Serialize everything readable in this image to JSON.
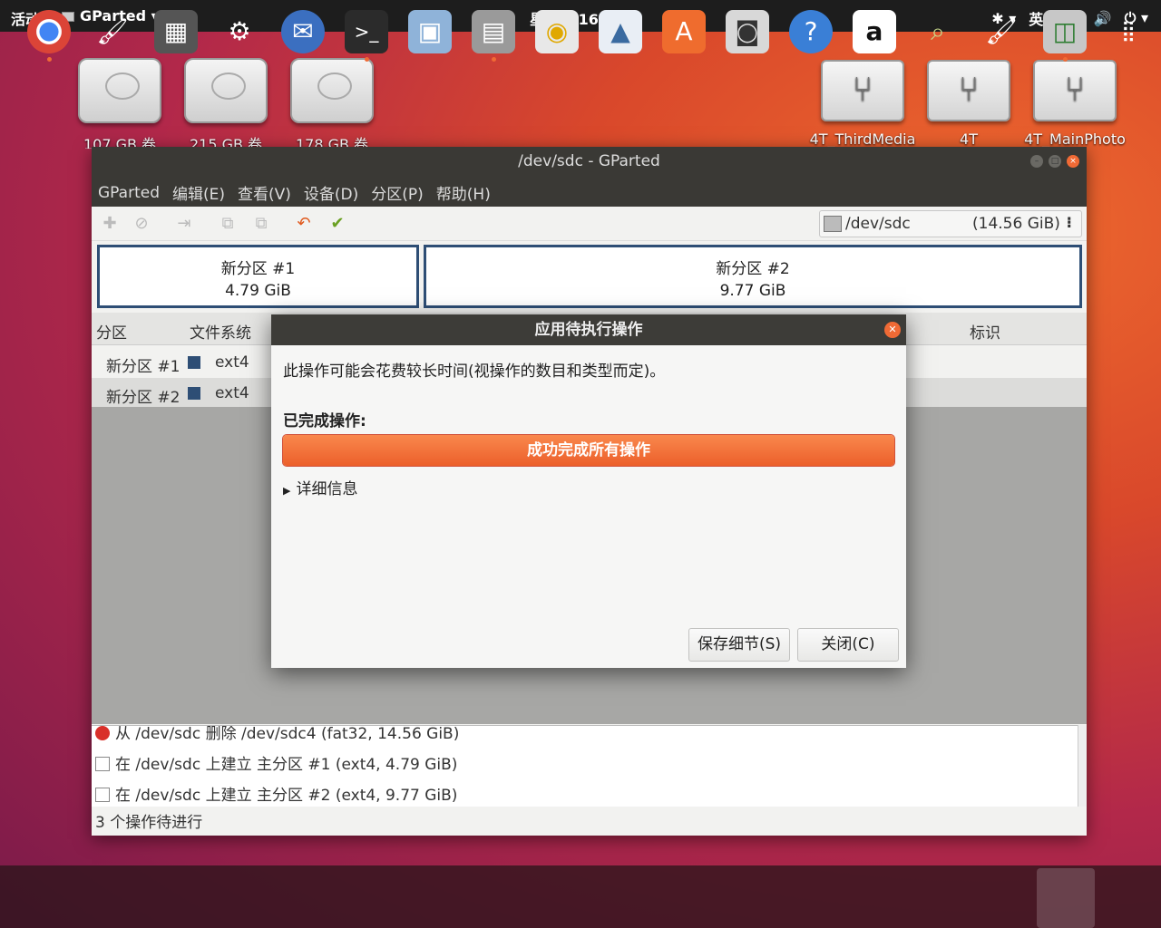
{
  "topbar": {
    "activities": "活动",
    "app_menu": "GParted ▾",
    "clock": "星期日 16：00",
    "tray": {
      "accessibility": "✱ ▾",
      "input_method": "英 ▾",
      "wifi": "◉",
      "volume": "🔊",
      "power": "⏻ ▾"
    }
  },
  "desktop": {
    "icons": [
      {
        "label": "107 GB 卷"
      },
      {
        "label": "215 GB 卷"
      },
      {
        "label": "178 GB 卷"
      },
      {
        "label": "4T_ThirdMedia"
      },
      {
        "label": "4T"
      },
      {
        "label": "4T_MainPhoto"
      }
    ]
  },
  "gparted": {
    "title": "/dev/sdc - GParted",
    "menu": [
      "GParted",
      "编辑(E)",
      "查看(V)",
      "设备(D)",
      "分区(P)",
      "帮助(H)"
    ],
    "device": {
      "path": "/dev/sdc",
      "size": "(14.56 GiB)",
      "more": "⁝"
    },
    "partitions": [
      {
        "name": "新分区 #1",
        "size": "4.79 GiB"
      },
      {
        "name": "新分区 #2",
        "size": "9.77 GiB"
      }
    ],
    "columns": {
      "partition": "分区",
      "filesystem": "文件系统",
      "flags": "标识"
    },
    "rows": [
      {
        "name": "新分区 #1",
        "fs": "ext4"
      },
      {
        "name": "新分区 #2",
        "fs": "ext4"
      }
    ],
    "operations": [
      "从 /dev/sdc 删除 /dev/sdc4 (fat32, 14.56 GiB)",
      "在 /dev/sdc 上建立 主分区 #1 (ext4, 4.79 GiB)",
      "在 /dev/sdc 上建立 主分区 #2 (ext4, 9.77 GiB)"
    ],
    "status": "3 个操作待进行"
  },
  "dialog": {
    "title": "应用待执行操作",
    "message": "此操作可能会花费较长时间(视操作的数目和类型而定)。",
    "completed_label": "已完成操作:",
    "progress_text": "成功完成所有操作",
    "progress_fraction": 1.0,
    "details_label": "详细信息",
    "save_button": "保存细节(S)",
    "close_button": "关闭(C)",
    "accent_color": "#ec5f2a"
  },
  "dock": {
    "apps": [
      "chrome-icon",
      "paint-icon",
      "calculator-icon",
      "settings-icon",
      "thunderbird-icon",
      "terminal-icon",
      "image-viewer-icon",
      "files-icon",
      "rhythmbox-icon",
      "image-editor-icon",
      "software-center-icon",
      "camera-icon",
      "help-icon",
      "amazon-icon",
      "screenshot-icon",
      "paint2-icon",
      "gparted-icon",
      "app-grid-icon"
    ]
  }
}
